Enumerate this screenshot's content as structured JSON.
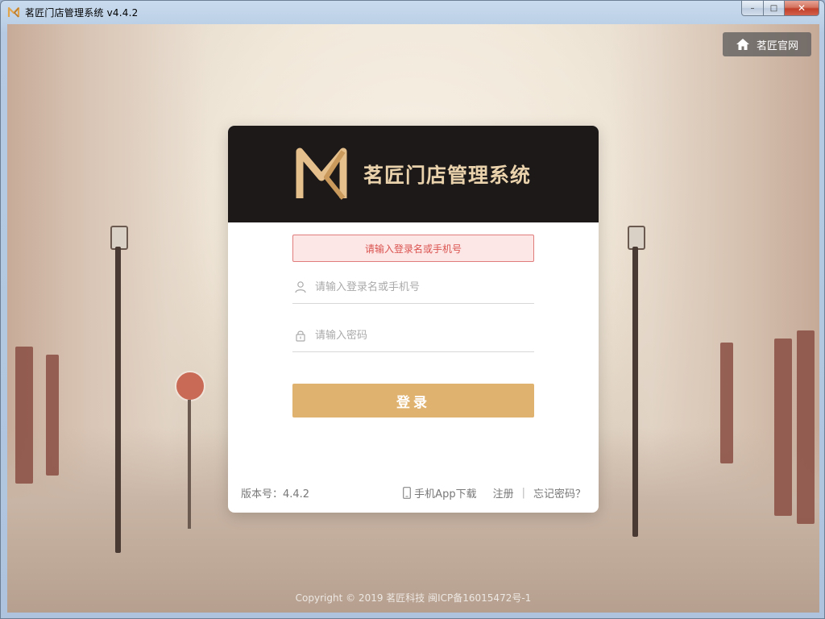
{
  "window": {
    "title": "茗匠门店管理系统 v4.4.2",
    "controls": {
      "minimize": "–",
      "maximize": "□",
      "close": "✕"
    }
  },
  "header_link": {
    "label": "茗匠官网",
    "icon": "home-icon"
  },
  "card": {
    "brand_name": "茗匠门店管理系统",
    "brand_colors": {
      "header_bg": "#1c1918",
      "logo": "#e6c08c",
      "name": "#ead2ac"
    },
    "alert": {
      "text": "请输入登录名或手机号",
      "color": "#d9534f"
    },
    "username": {
      "placeholder": "请输入登录名或手机号",
      "icon": "user-icon"
    },
    "password": {
      "placeholder": "请输入密码",
      "icon": "lock-icon"
    },
    "login_button": {
      "label": "登录",
      "color": "#e0b26f"
    },
    "footer": {
      "version": "版本号：4.4.2",
      "app_download": "手机App下载",
      "register": "注册",
      "separator": "|",
      "forgot_password": "忘记密码？"
    }
  },
  "copyright": "Copyright © 2019 茗匠科技 闽ICP备16015472号-1"
}
